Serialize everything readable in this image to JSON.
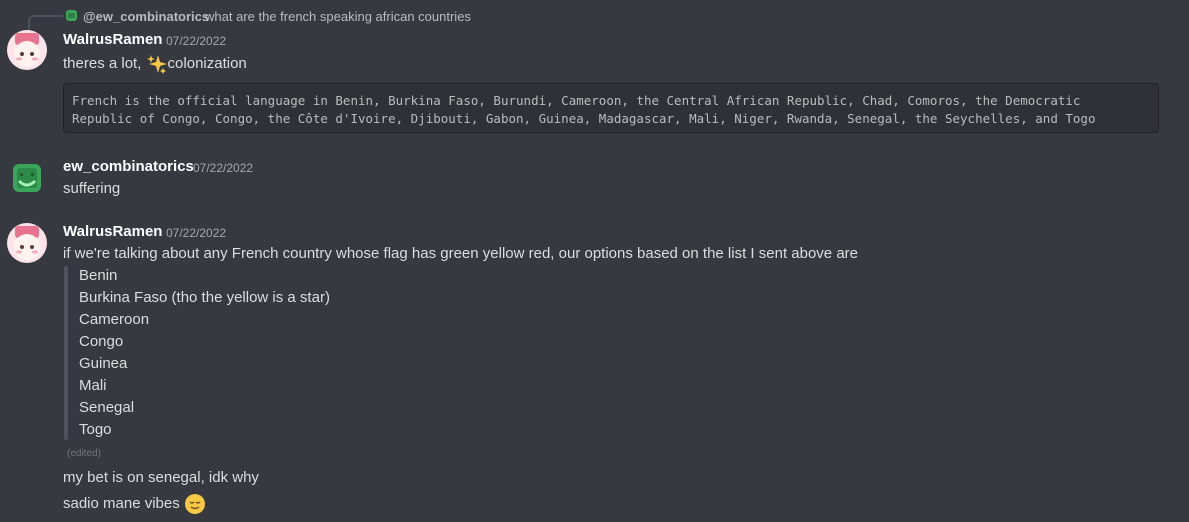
{
  "reply": {
    "author": "@ew_combinatorics",
    "text": "what are the french speaking african countries"
  },
  "messages": [
    {
      "author": "WalrusRamen",
      "timestamp": "07/22/2022",
      "text_before_emoji": "theres a lot, ",
      "emoji": "sparkles",
      "text_after_emoji": "colonization",
      "code_lines": [
        "French is the official language in Benin, Burkina Faso, Burundi, Cameroon, the Central African Republic, Chad, Comoros, the Democratic",
        "Republic of Congo, Congo, the Côte d'Ivoire, Djibouti, Gabon, Guinea, Madagascar, Mali, Niger, Rwanda, Senegal, the Seychelles, and Togo"
      ]
    },
    {
      "author": "ew_combinatorics",
      "timestamp": "07/22/2022",
      "text": "suffering"
    },
    {
      "author": "WalrusRamen",
      "timestamp": "07/22/2022",
      "text": "if we're talking about any French country whose flag has green yellow red, our options based on the list I sent above are",
      "quote_items": [
        "Benin",
        "Burkina Faso (tho the yellow is a star)",
        "Cameroon",
        "Congo",
        "Guinea",
        "Mali",
        "Senegal",
        "Togo"
      ],
      "edited_label": "(edited)",
      "followup_1": "my bet is on senegal, idk why",
      "followup_2": "sadio mane vibes",
      "followup_2_emoji": "relieved-face"
    }
  ],
  "colors": {
    "background": "#36393f",
    "text": "#dcddde",
    "muted": "#a3a6aa",
    "codeblock_bg": "#2f3136"
  }
}
